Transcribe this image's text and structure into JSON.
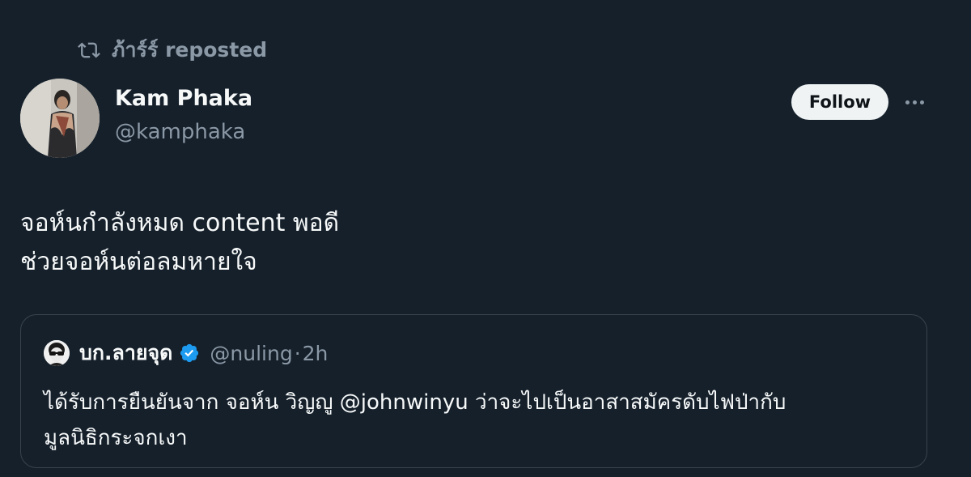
{
  "repost": {
    "icon": "repost-icon",
    "label": "ภ้าร์ร์ reposted"
  },
  "author": {
    "avatar": "avatar",
    "name": "Kam Phaka",
    "handle": "@kamphaka"
  },
  "actions": {
    "follow_label": "Follow",
    "more_icon": "more-icon"
  },
  "tweet": {
    "lines": [
      "จอห์นกำลังหมด content พอดี",
      "ช่วยจอห์นต่อลมหายใจ"
    ]
  },
  "quote": {
    "name": "บก.ลายจุด",
    "verified_icon": "verified-badge-icon",
    "handle": "@nuling",
    "dot": "·",
    "time": "2h",
    "lines": [
      "ได้รับการยืนยันจาก จอห์น วิญญู @johnwinyu  ว่าจะไปเป็นอาสาสมัครดับไฟป่ากับ",
      "มูลนิธิกระจกเงา"
    ]
  },
  "colors": {
    "background": "#15202b",
    "text_primary": "#f7f9f9",
    "text_secondary": "#8b98a5",
    "border": "#38444d",
    "follow_bg": "#eff3f4",
    "verified_blue": "#1d9bf0"
  }
}
